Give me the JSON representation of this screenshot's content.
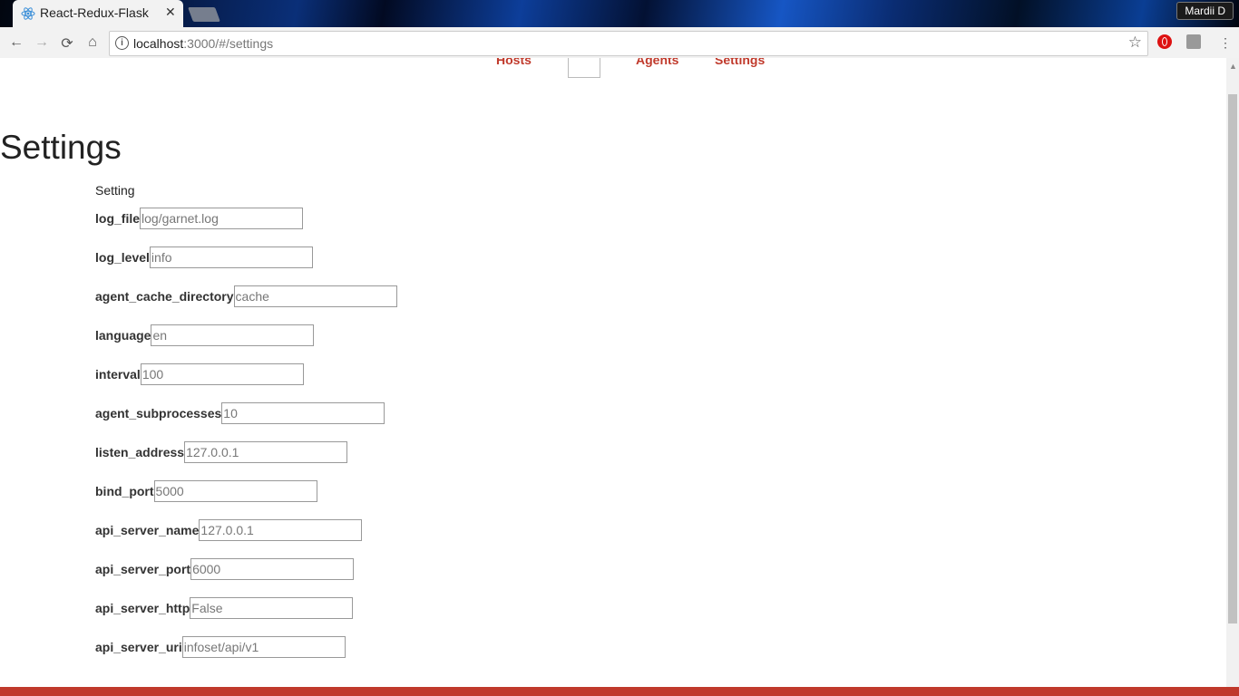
{
  "browser": {
    "tab_title": "React-Redux-Flask",
    "tab_close": "✕",
    "user": "Mardii D",
    "url_host": "localhost",
    "url_rest": ":3000/#/settings"
  },
  "nav": {
    "hosts": "Hosts",
    "agents": "Agents",
    "settings": "Settings"
  },
  "page": {
    "title": "Settings",
    "section": "Setting"
  },
  "fields": [
    {
      "label": "log_file",
      "placeholder": "log/garnet.log"
    },
    {
      "label": "log_level",
      "placeholder": "info"
    },
    {
      "label": "agent_cache_directory",
      "placeholder": "cache"
    },
    {
      "label": "language",
      "placeholder": "en"
    },
    {
      "label": "interval",
      "placeholder": "100"
    },
    {
      "label": "agent_subprocesses",
      "placeholder": "10"
    },
    {
      "label": "listen_address",
      "placeholder": "127.0.0.1"
    },
    {
      "label": "bind_port",
      "placeholder": "5000"
    },
    {
      "label": "api_server_name",
      "placeholder": "127.0.0.1"
    },
    {
      "label": "api_server_port",
      "placeholder": "6000"
    },
    {
      "label": "api_server_http",
      "placeholder": "False"
    },
    {
      "label": "api_server_uri",
      "placeholder": "infoset/api/v1"
    }
  ],
  "colors": {
    "accent": "#c0392b"
  }
}
